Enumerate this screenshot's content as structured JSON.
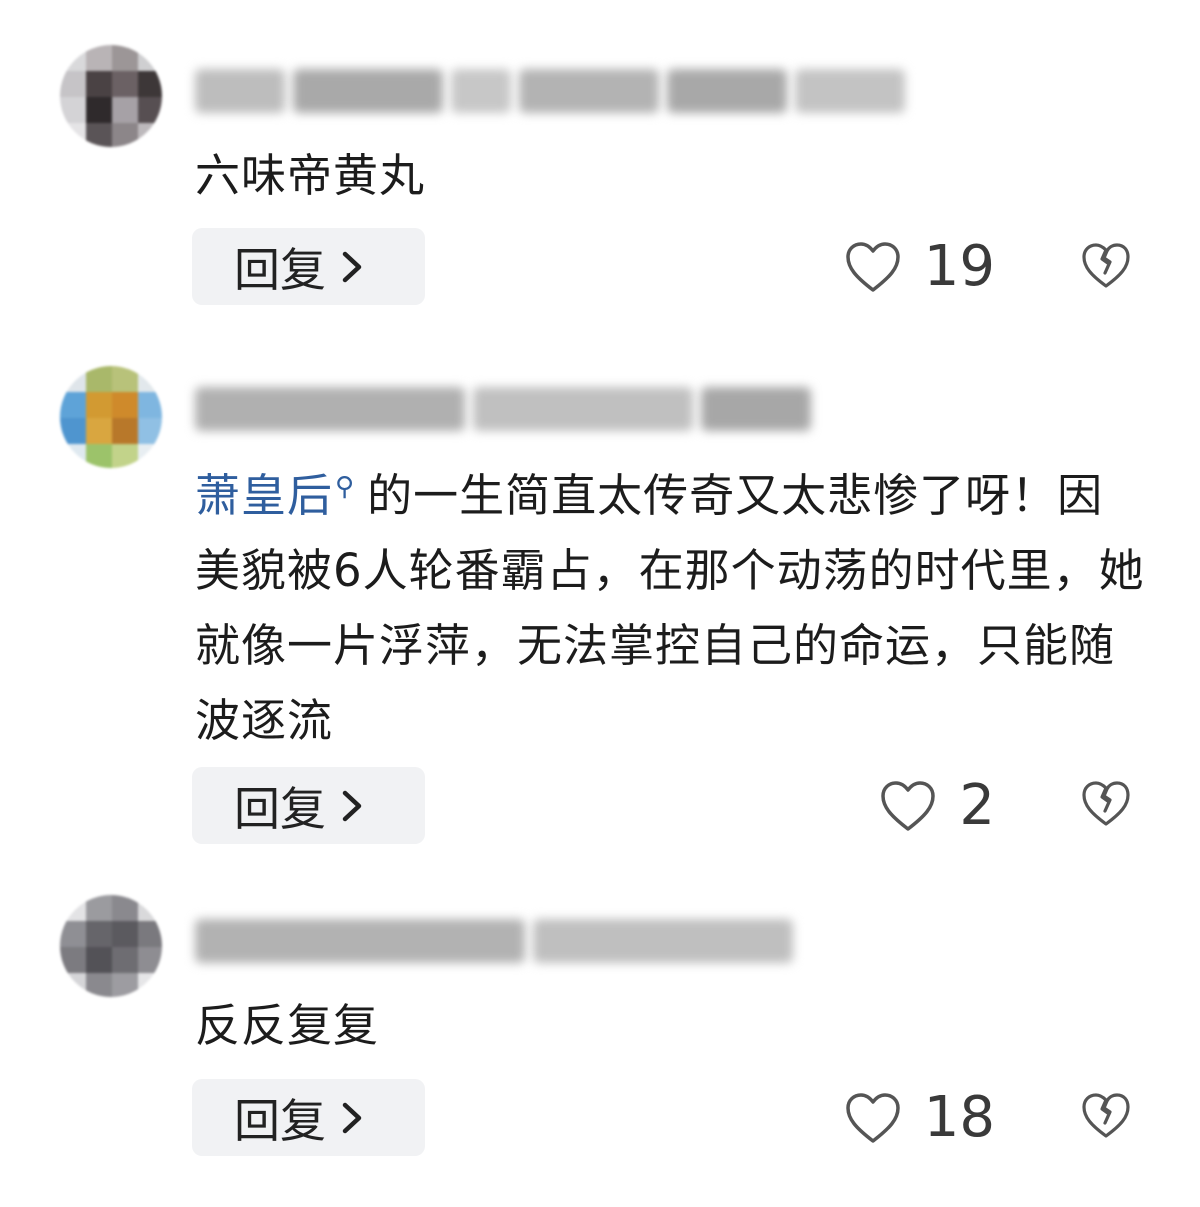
{
  "comments": [
    {
      "text": "六味帝黄丸",
      "reply_label": "回复",
      "like_count": "19"
    },
    {
      "mention": "萧皇后",
      "mention_icon": "search-icon",
      "text": "的一生简直太传奇又太悲惨了呀！因美貌被6人轮番霸占，在那个动荡的时代里，她就像一片浮萍，无法掌控自己的命运，只能随波逐流",
      "reply_label": "回复",
      "like_count": "2"
    },
    {
      "text": "反反复复",
      "reply_label": "回复",
      "like_count": "18"
    }
  ],
  "colors": {
    "mention": "#2f5e9e",
    "reply_bg": "#f1f2f4",
    "icon_stroke": "#555555"
  }
}
